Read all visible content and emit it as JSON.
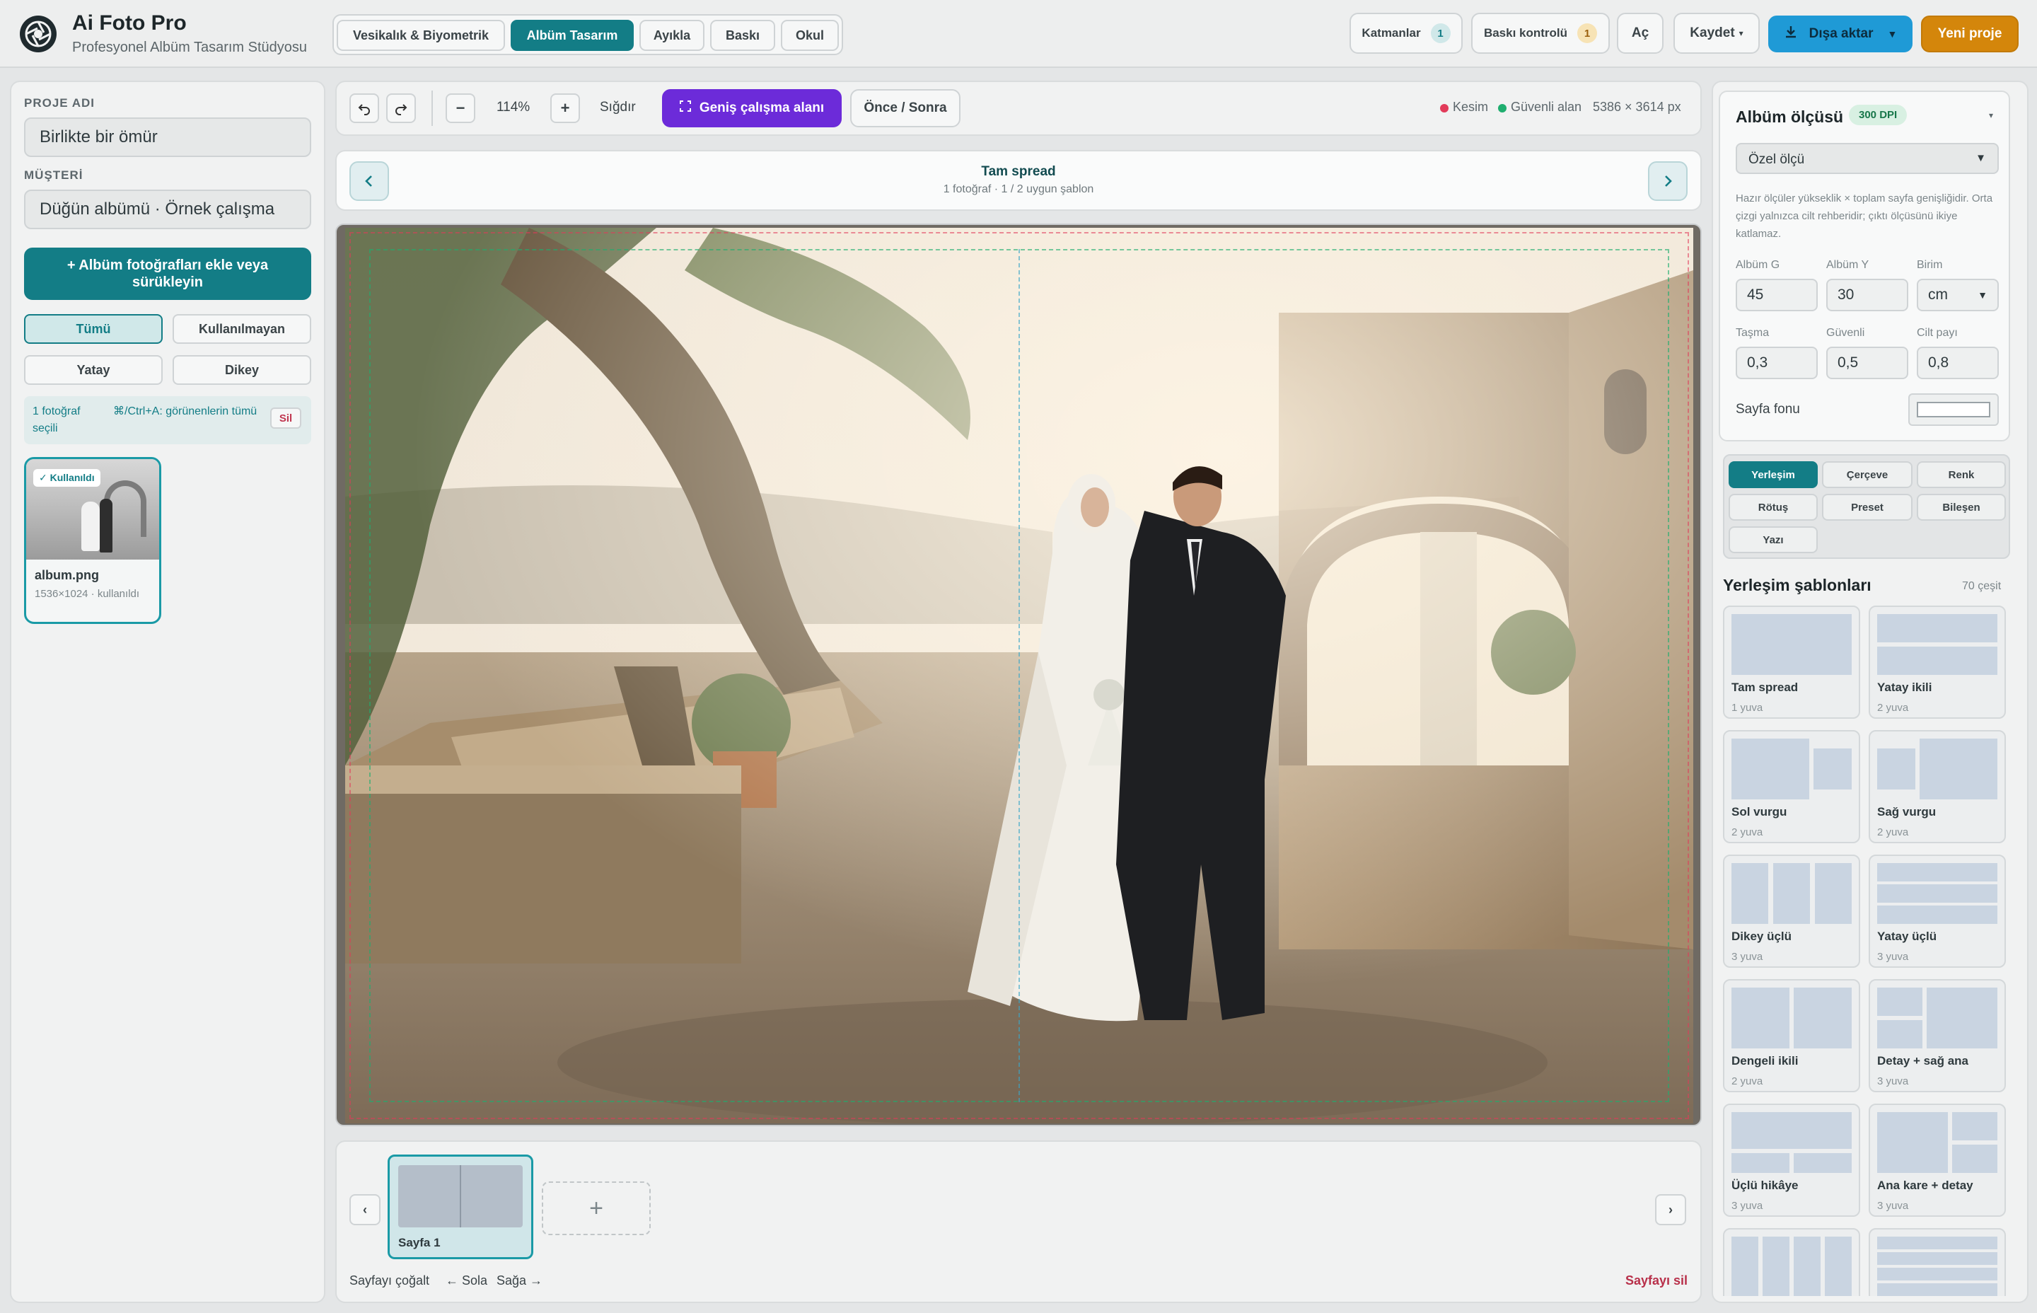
{
  "app": {
    "title": "Ai Foto Pro",
    "subtitle": "Profesyonel Albüm Tasarım Stüdyosu"
  },
  "header": {
    "mode_tabs": [
      {
        "label": "Vesikalık & Biyometrik",
        "active": false
      },
      {
        "label": "Albüm Tasarım",
        "active": true
      },
      {
        "label": "Ayıkla",
        "active": false
      },
      {
        "label": "Baskı",
        "active": false
      },
      {
        "label": "Okul",
        "active": false
      }
    ],
    "layers": {
      "label": "Katmanlar",
      "count": "1"
    },
    "print_check": {
      "label": "Baskı kontrolü",
      "count": "1"
    },
    "open": "Aç",
    "save": "Kaydet",
    "export": "Dışa aktar",
    "new_project": "Yeni proje"
  },
  "left": {
    "project_label": "PROJE ADI",
    "project_value": "Birlikte bir ömür",
    "client_label": "MÜŞTERİ",
    "client_value": "Düğün albümü · Örnek çalışma",
    "add_photos": "+ Albüm fotoğrafları ekle veya sürükleyin",
    "filters": [
      "Tümü",
      "Kullanılmayan",
      "Yatay",
      "Dikey"
    ],
    "selection_count": "1 fotoğraf seçili",
    "selection_hint": "⌘/Ctrl+A: görünenlerin tümü",
    "delete": "Sil",
    "photo": {
      "badge": "✓ Kullanıldı",
      "name": "album.png",
      "meta": "1536×1024 · kullanıldı"
    }
  },
  "toolbar": {
    "zoom": "114%",
    "fit": "Sığdır",
    "wide": "Geniş çalışma alanı",
    "before_after": "Önce / Sonra",
    "legend_cut": "Kesim",
    "legend_safe": "Güvenli alan",
    "dims": "5386 × 3614 px"
  },
  "spread_nav": {
    "title": "Tam spread",
    "subtitle": "1 fotoğraf · 1 / 2 uygun şablon"
  },
  "pages": {
    "page1": "Sayfa 1",
    "duplicate": "Sayfayı çoğalt",
    "left": "← Sola",
    "right": "Sağa →",
    "delete": "Sayfayı sil"
  },
  "right": {
    "size_title": "Albüm ölçüsü",
    "dpi": "300 DPI",
    "preset": "Özel ölçü",
    "help": "Hazır ölçüler yükseklik × toplam sayfa genişliğidir. Orta çizgi yalnızca cilt rehberidir; çıktı ölçüsünü ikiye katlamaz.",
    "width_label": "Albüm G",
    "width": "45",
    "height_label": "Albüm Y",
    "height": "30",
    "unit_label": "Birim",
    "unit": "cm",
    "bleed_label": "Taşma",
    "bleed": "0,3",
    "safe_label": "Güvenli",
    "safe": "0,5",
    "spine_label": "Cilt payı",
    "spine": "0,8",
    "bg_label": "Sayfa fonu",
    "tabs": [
      "Yerleşim",
      "Çerçeve",
      "Renk",
      "Rötuş",
      "Preset",
      "Bileşen",
      "Yazı"
    ],
    "templates_title": "Yerleşim şablonları",
    "templates_count": "70 çeşit",
    "templates": [
      {
        "name": "Tam spread",
        "slots": "1 yuva"
      },
      {
        "name": "Yatay ikili",
        "slots": "2 yuva"
      },
      {
        "name": "Sol vurgu",
        "slots": "2 yuva"
      },
      {
        "name": "Sağ vurgu",
        "slots": "2 yuva"
      },
      {
        "name": "Dikey üçlü",
        "slots": "3 yuva"
      },
      {
        "name": "Yatay üçlü",
        "slots": "3 yuva"
      },
      {
        "name": "Dengeli ikili",
        "slots": "2 yuva"
      },
      {
        "name": "Detay + sağ ana",
        "slots": "3 yuva"
      },
      {
        "name": "Üçlü hikâye",
        "slots": "3 yuva"
      },
      {
        "name": "Ana kare + detay",
        "slots": "3 yuva"
      }
    ]
  },
  "colors": {
    "teal": "#0f7b86",
    "purple": "#6c2bd9",
    "orange": "#d4860b",
    "brown": "#9a5f0d",
    "cut": "#e23b5a",
    "safe": "#1fae6f"
  }
}
